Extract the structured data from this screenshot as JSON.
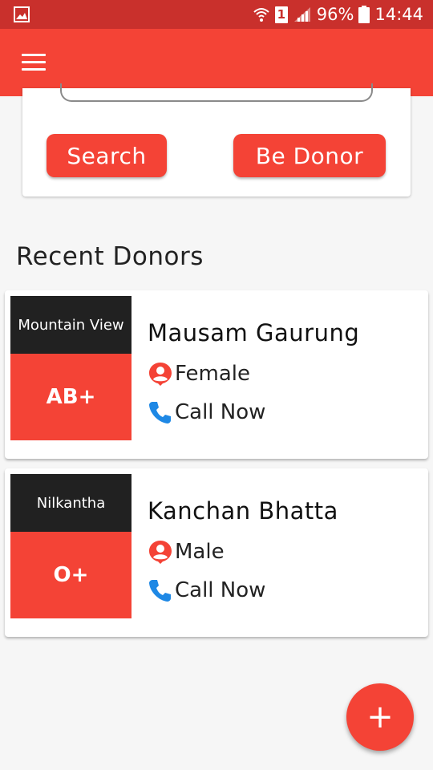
{
  "status_bar": {
    "sim_slot": "1",
    "battery": "96%",
    "time": "14:44"
  },
  "search_card": {
    "search_label": "Search",
    "be_donor_label": "Be Donor"
  },
  "recent_title": "Recent Donors",
  "donors": [
    {
      "location": "Mountain View",
      "blood_group": "AB+",
      "name": "Mausam Gaurung",
      "gender": "Female",
      "call_label": "Call Now"
    },
    {
      "location": "Nilkantha",
      "blood_group": "O+",
      "name": "Kanchan Bhatta",
      "gender": "Male",
      "call_label": "Call Now"
    }
  ],
  "fab_label": "+",
  "colors": {
    "accent": "#f44336",
    "status_bar": "#c9302c",
    "badge_dark": "#212121",
    "phone_icon": "#1e88e5"
  },
  "icons": {
    "menu": "hamburger-menu-icon",
    "gender": "person-pin-icon",
    "call": "phone-icon"
  }
}
